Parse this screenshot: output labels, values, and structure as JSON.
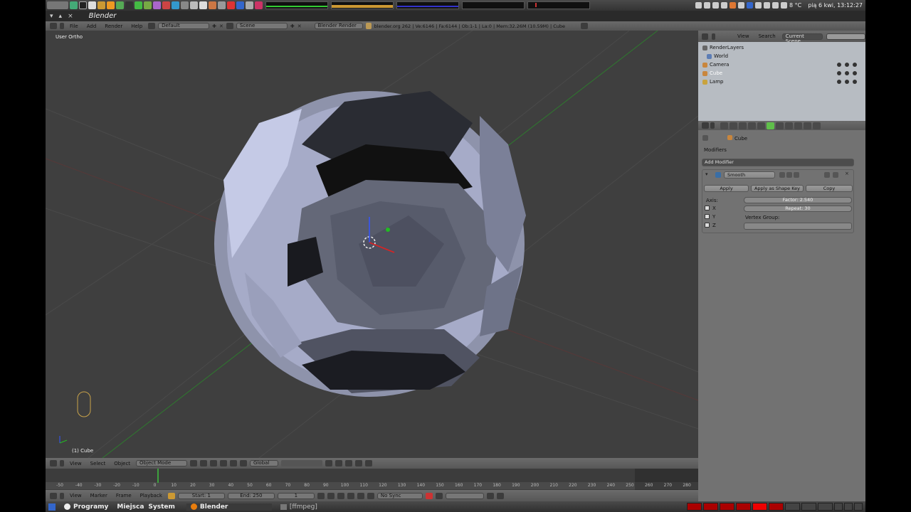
{
  "topbar": {
    "launchers": [
      "gnome-foot-icon",
      "terminal-icon",
      "folder-icon",
      "text-editor-icon",
      "image-viewer-icon",
      "calc-icon",
      "browser-icon",
      "mail-icon",
      "media-icon",
      "gimp-icon",
      "chat-icon",
      "ftp-icon",
      "globe-icon",
      "chrome-icon",
      "disk-icon",
      "burner-icon",
      "flower-icon",
      "settings-icon",
      "pdf-icon",
      "network-icon",
      "ruler-icon",
      "vlc-icon"
    ],
    "weather": "8 °C",
    "datetime": "pią  6 kwi, 13:12:27"
  },
  "window": {
    "title": "Blender"
  },
  "info_header": {
    "menus": [
      "File",
      "Add",
      "Render",
      "Help"
    ],
    "screen_layout": "Default",
    "scene": "Scene",
    "engine": "Blender Render",
    "stats": "blender.org 262 | Ve:6146 | Fa:6144 | Ob:1-1 | La:0 | Mem:32.26M (10.59M) | Cube"
  },
  "viewport": {
    "label": "User Ortho",
    "object_info": "(1) Cube"
  },
  "view3d_header": {
    "menus": [
      "View",
      "Select",
      "Object"
    ],
    "mode": "Object Mode",
    "orientation": "Global"
  },
  "timeline": {
    "ticks": [
      "-50",
      "-40",
      "-30",
      "-20",
      "-10",
      "0",
      "10",
      "20",
      "30",
      "40",
      "50",
      "60",
      "70",
      "80",
      "90",
      "100",
      "110",
      "120",
      "130",
      "140",
      "150",
      "160",
      "170",
      "180",
      "190",
      "200",
      "210",
      "220",
      "230",
      "240",
      "250",
      "260",
      "270",
      "280"
    ],
    "current_frame": 1
  },
  "timeline_header": {
    "menus": [
      "View",
      "Marker",
      "Frame",
      "Playback"
    ],
    "start": "Start: 1",
    "end": "End: 250",
    "frame": "1",
    "sync": "No Sync"
  },
  "outliner": {
    "menus": [
      "View",
      "Search"
    ],
    "scene_select": "Current Scene",
    "items": [
      {
        "label": "RenderLayers",
        "icon": "render-layers-icon"
      },
      {
        "label": "World",
        "icon": "world-icon"
      },
      {
        "label": "Camera",
        "icon": "camera-icon"
      },
      {
        "label": "Cube",
        "icon": "mesh-icon"
      },
      {
        "label": "Lamp",
        "icon": "lamp-icon"
      }
    ]
  },
  "properties": {
    "context": "Cube",
    "panel": "Modifiers",
    "add_modifier": "Add Modifier",
    "modifier_name": "Smooth",
    "buttons": {
      "apply": "Apply",
      "apply_shape": "Apply as Shape Key",
      "copy": "Copy"
    },
    "axis_label": "Axis:",
    "axes": [
      "X",
      "Y",
      "Z"
    ],
    "factor": "Factor: 2.540",
    "repeat": "Repeat: 30",
    "vertex_group_label": "Vertex Group:"
  },
  "taskbar": {
    "menus": [
      "Programy",
      "Miejsca",
      "System"
    ],
    "tasks": [
      "Blender",
      "[ffmpeg]"
    ]
  }
}
